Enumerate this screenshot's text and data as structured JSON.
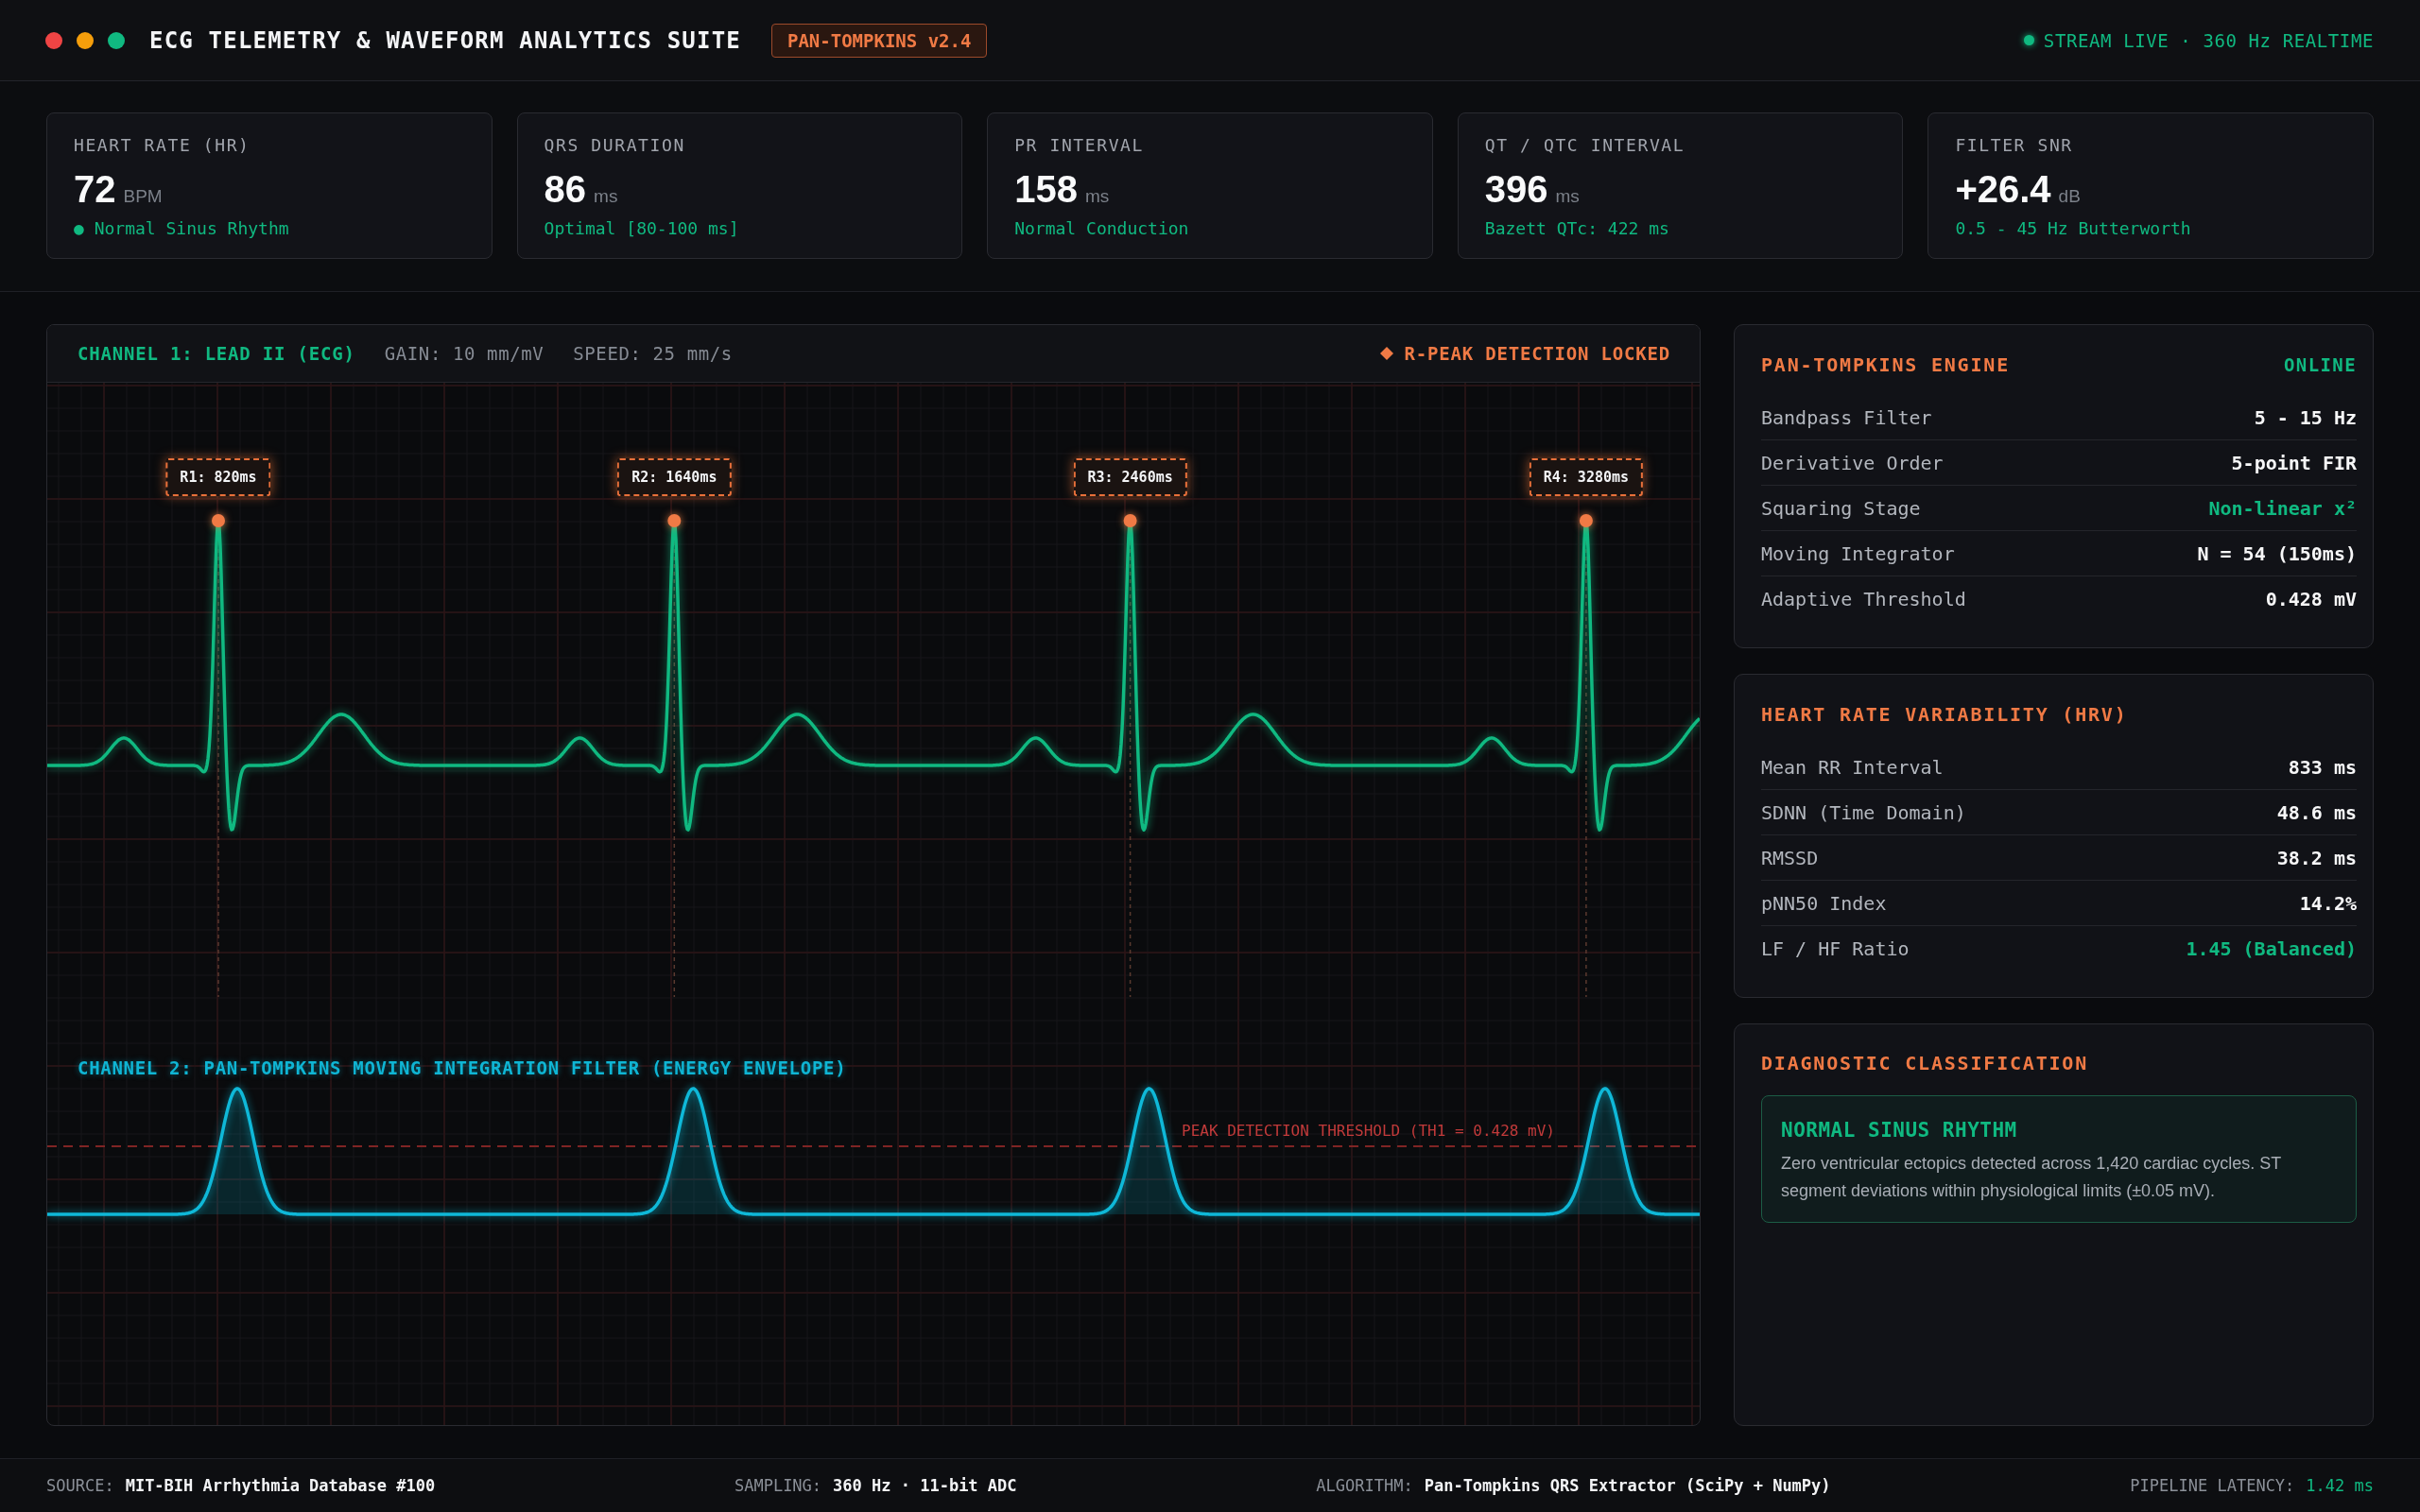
{
  "header": {
    "window_controls": [
      {
        "color": "#ef4444"
      },
      {
        "color": "#f59e0b"
      },
      {
        "color": "#10b981"
      }
    ],
    "title": "ECG TELEMETRY & WAVEFORM ANALYTICS SUITE",
    "version_badge": "PAN-TOMPKINS v2.4",
    "stream_status": "STREAM LIVE · 360 Hz REALTIME"
  },
  "metrics": [
    {
      "label": "HEART RATE (HR)",
      "value": "72",
      "unit": "BPM",
      "note": "● Normal Sinus Rhythm"
    },
    {
      "label": "QRS DURATION",
      "value": "86",
      "unit": "ms",
      "note": "Optimal [80-100 ms]"
    },
    {
      "label": "PR INTERVAL",
      "value": "158",
      "unit": "ms",
      "note": "Normal Conduction"
    },
    {
      "label": "QT / QTC INTERVAL",
      "value": "396",
      "unit": "ms",
      "note": "Bazett QTc: 422 ms"
    },
    {
      "label": "FILTER SNR",
      "value": "+26.4",
      "unit": "dB",
      "note": "0.5 - 45 Hz Butterworth"
    }
  ],
  "channel_1": {
    "title": "CHANNEL 1: LEAD II (ECG)",
    "gain": "GAIN: 10 mm/mV",
    "speed": "SPEED: 25 mm/s",
    "detection_status": "R-PEAK DETECTION LOCKED",
    "r_peaks": [
      {
        "label": "R1: 820ms"
      },
      {
        "label": "R2: 1640ms"
      },
      {
        "label": "R3: 2460ms"
      },
      {
        "label": "R4: 3280ms"
      }
    ]
  },
  "channel_2": {
    "title": "CHANNEL 2: PAN-TOMPKINS MOVING INTEGRATION FILTER (ENERGY ENVELOPE)",
    "threshold_label": "PEAK DETECTION THRESHOLD (TH1 = 0.428 mV)"
  },
  "engine_panel": {
    "title": "PAN-TOMPKINS ENGINE",
    "status": "ONLINE",
    "rows": [
      {
        "label": "Bandpass Filter",
        "value": "5 - 15 Hz",
        "highlight": false
      },
      {
        "label": "Derivative Order",
        "value": "5-point FIR",
        "highlight": false
      },
      {
        "label": "Squaring Stage",
        "value": "Non-linear x²",
        "highlight": true
      },
      {
        "label": "Moving Integrator",
        "value": "N = 54 (150ms)",
        "highlight": false
      },
      {
        "label": "Adaptive Threshold",
        "value": "0.428 mV",
        "highlight": false
      }
    ]
  },
  "hrv_panel": {
    "title": "HEART RATE VARIABILITY (HRV)",
    "rows": [
      {
        "label": "Mean RR Interval",
        "value": "833 ms",
        "highlight": false
      },
      {
        "label": "SDNN (Time Domain)",
        "value": "48.6 ms",
        "highlight": false
      },
      {
        "label": "RMSSD",
        "value": "38.2 ms",
        "highlight": false
      },
      {
        "label": "pNN50 Index",
        "value": "14.2%",
        "highlight": false
      },
      {
        "label": "LF / HF Ratio",
        "value": "1.45 (Balanced)",
        "highlight": true
      }
    ]
  },
  "diagnostic_panel": {
    "title": "DIAGNOSTIC CLASSIFICATION",
    "result": {
      "title": "NORMAL SINUS RHYTHM",
      "description": "Zero ventricular ectopics detected across 1,420 cardiac cycles. ST segment deviations within physiological limits (±0.05 mV)."
    }
  },
  "status_bar": [
    {
      "label": "SOURCE:",
      "value": "MIT-BIH Arrhythmia Database #100",
      "highlight": false
    },
    {
      "label": "SAMPLING:",
      "value": "360 Hz · 11-bit ADC",
      "highlight": false
    },
    {
      "label": "ALGORITHM:",
      "value": "Pan-Tompkins QRS Extractor (SciPy + NumPy)",
      "highlight": false
    },
    {
      "label": "PIPELINE LATENCY:",
      "value": "1.42 ms",
      "highlight": true
    }
  ]
}
